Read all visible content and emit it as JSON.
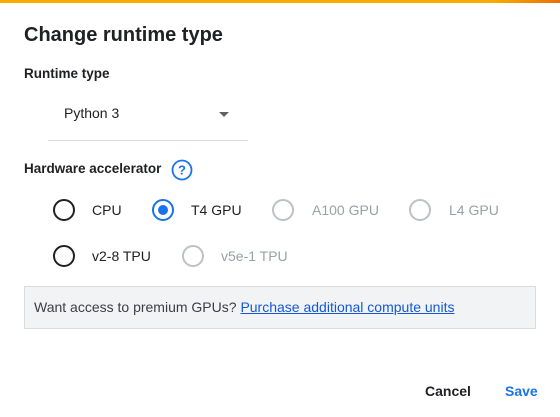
{
  "dialog": {
    "title": "Change runtime type",
    "runtime_type_label": "Runtime type",
    "runtime_type_value": "Python 3",
    "hardware_label": "Hardware accelerator",
    "hardware_options": [
      {
        "label": "CPU",
        "selected": false,
        "disabled": false
      },
      {
        "label": "T4 GPU",
        "selected": true,
        "disabled": false
      },
      {
        "label": "A100 GPU",
        "selected": false,
        "disabled": true
      },
      {
        "label": "L4 GPU",
        "selected": false,
        "disabled": true
      },
      {
        "label": "v2-8 TPU",
        "selected": false,
        "disabled": false
      },
      {
        "label": "v5e-1 TPU",
        "selected": false,
        "disabled": true
      }
    ],
    "premium_text": "Want access to premium GPUs?",
    "premium_link": "Purchase additional compute units",
    "cancel_label": "Cancel",
    "save_label": "Save"
  },
  "colors": {
    "accent": "#1a73e8",
    "top_bar": "#f9ab00",
    "disabled": "#9aa0a6"
  },
  "icons": {
    "help": "help-circle-icon",
    "dropdown": "caret-down-icon"
  }
}
